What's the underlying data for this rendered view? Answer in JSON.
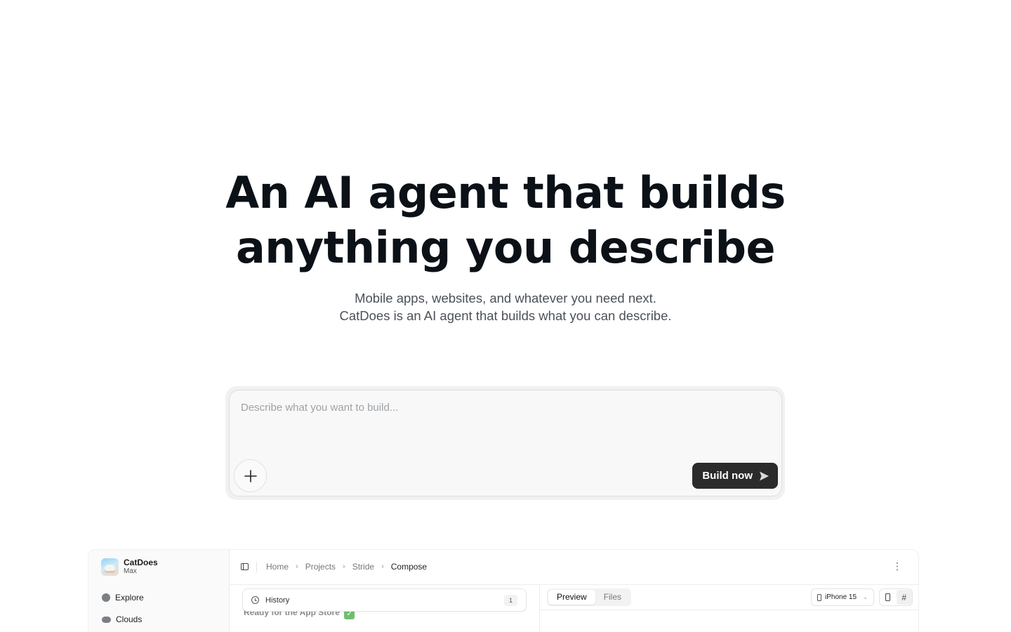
{
  "hero": {
    "title_line1": "An AI agent that builds",
    "title_line2": "anything you describe",
    "subtitle_line1": "Mobile apps, websites, and whatever you need next.",
    "subtitle_line2": "CatDoes is an AI agent that builds what you can describe."
  },
  "prompt": {
    "placeholder": "Describe what you want to build...",
    "add_icon": "plus-icon",
    "build_label": "Build now",
    "build_icon": "send-arrow-icon"
  },
  "app_preview": {
    "brand": {
      "name": "CatDoes",
      "plan": "Max",
      "avatar_icon": "cat-avatar-icon"
    },
    "nav": [
      {
        "label": "Explore",
        "icon": "compass-icon"
      },
      {
        "label": "Clouds",
        "icon": "cloud-icon"
      }
    ],
    "breadcrumbs": [
      "Home",
      "Projects",
      "Stride",
      "Compose"
    ],
    "history": {
      "label": "History",
      "count": "1"
    },
    "message": "Ready for the App Store",
    "preview_tabs": [
      "Preview",
      "Files"
    ],
    "active_tab": "Preview",
    "device": "iPhone 15"
  }
}
